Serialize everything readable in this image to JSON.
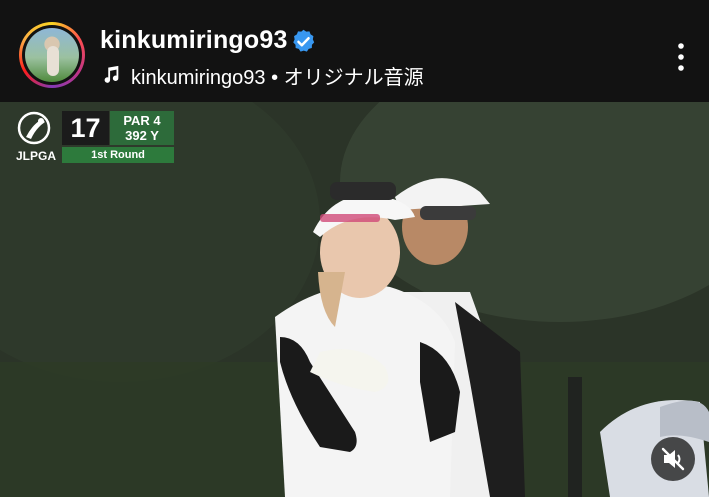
{
  "header": {
    "username": "kinkumiringo93",
    "audio_label": "kinkumiringo93 • オリジナル音源"
  },
  "scoreboard": {
    "logo_text": "JLPGA",
    "hole": "17",
    "par": "PAR 4",
    "yards": "392 Y",
    "round": "1st Round"
  },
  "icons": {
    "verified": "verified-badge-icon",
    "music": "music-note-icon",
    "more": "more-vertical-icon",
    "mute": "muted-speaker-icon"
  },
  "colors": {
    "background": "#121212",
    "verified": "#3897f0",
    "scoreboard_green": "#2d7a3c"
  }
}
